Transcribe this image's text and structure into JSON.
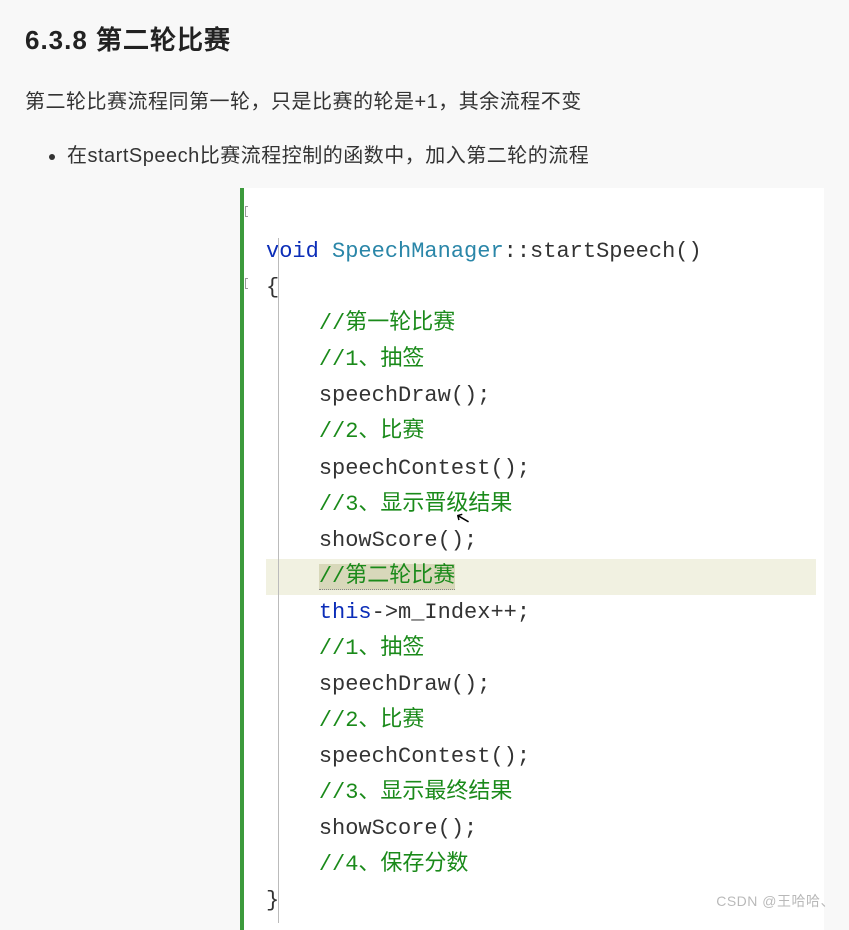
{
  "heading": "6.3.8 第二轮比赛",
  "paragraph": "第二轮比赛流程同第一轮，只是比赛的轮是+1，其余流程不变",
  "bullet": "在startSpeech比赛流程控制的函数中，加入第二轮的流程",
  "code": {
    "kw_void": "void",
    "type_name": "SpeechManager",
    "fn_decl_tail": "::startSpeech()",
    "brace_open": "{",
    "c_round1": "//第一轮比赛",
    "c_draw1": "//1、抽签",
    "l_draw1": "speechDraw();",
    "c_contest1": "//2、比赛",
    "l_contest1": "speechContest();",
    "c_show1": "//3、显示晋级结果",
    "l_show1": "showScore();",
    "c_round2": "//第二轮比赛",
    "kw_this": "this",
    "l_index_tail": "->m_Index++;",
    "c_draw2": "//1、抽签",
    "l_draw2": "speechDraw();",
    "c_contest2": "//2、比赛",
    "l_contest2": "speechContest();",
    "c_show2": "//3、显示最终结果",
    "l_show2": "showScore();",
    "c_save": "//4、保存分数",
    "brace_close": "}"
  },
  "watermark": "CSDN @王哈哈、"
}
